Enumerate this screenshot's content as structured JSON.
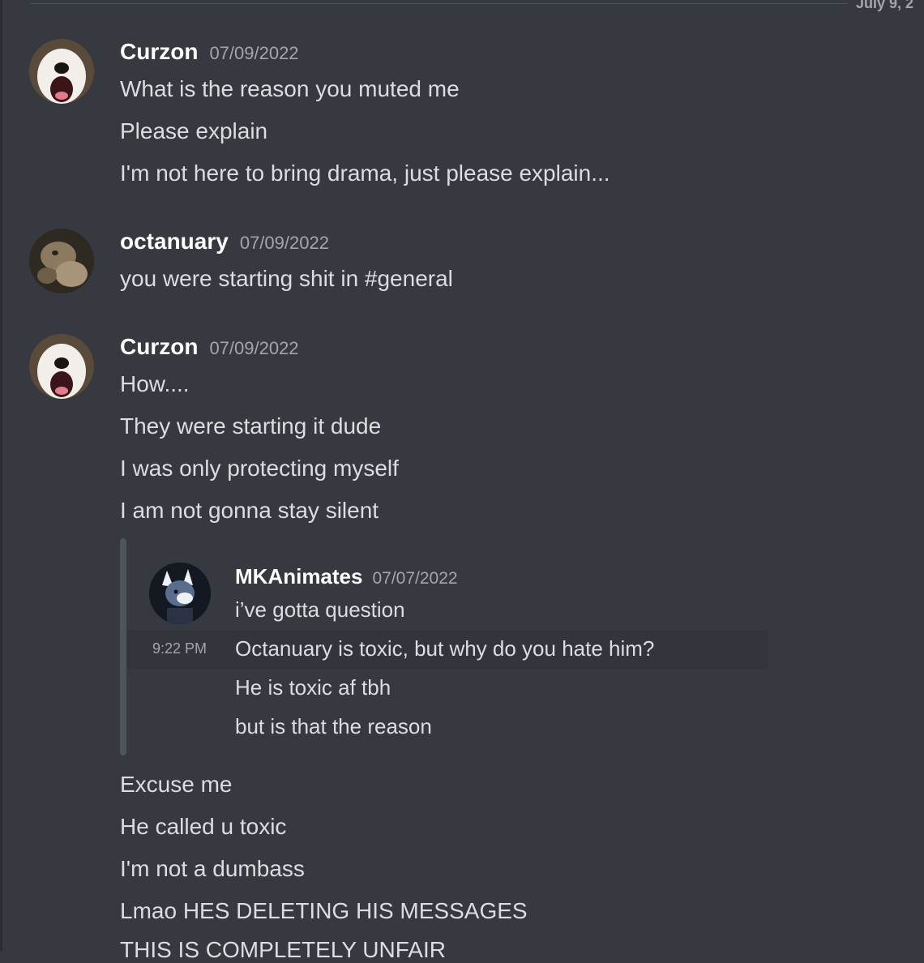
{
  "divider": {
    "date": "July 9, 2"
  },
  "messages": [
    {
      "author": "Curzon",
      "timestamp": "07/09/2022",
      "lines": [
        "What is the reason you muted me",
        "Please explain",
        "I'm not here to bring drama, just please explain..."
      ]
    },
    {
      "author": "octanuary",
      "timestamp": "07/09/2022",
      "lines": [
        "you were starting shit in #general"
      ]
    },
    {
      "author": "Curzon",
      "timestamp": "07/09/2022",
      "lines": [
        "How....",
        "They were starting it dude",
        "I was only protecting myself",
        "I am not gonna stay silent"
      ],
      "after_lines": [
        "Excuse me",
        "He called u toxic",
        "I'm not a dumbass",
        "Lmao HES DELETING HIS MESSAGES",
        "THIS IS COMPLETELY UNFAIR"
      ]
    }
  ],
  "quote": {
    "author": "MKAnimates",
    "timestamp": "07/07/2022",
    "hover_time": "9:22 PM",
    "lines": [
      "i’ve gotta question",
      "Octanuary is toxic, but why do you hate him?",
      "He is toxic af tbh",
      "but is that the reason"
    ]
  },
  "colors": {
    "background": "#36393f",
    "text": "#dcddde",
    "muted": "#a3a6aa",
    "author": "#ffffff"
  }
}
